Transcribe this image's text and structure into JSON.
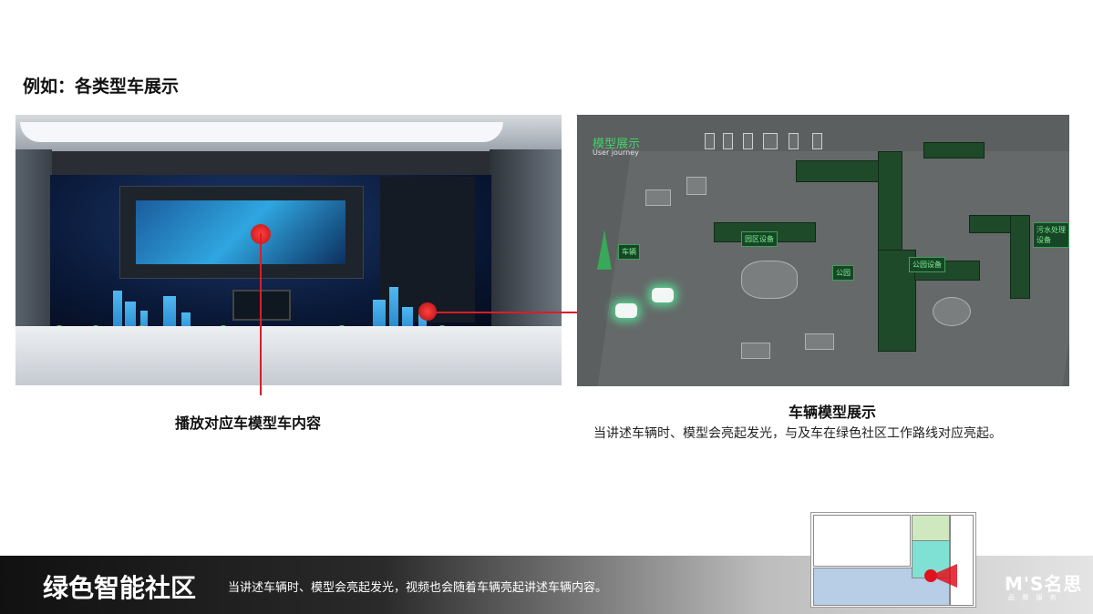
{
  "page": {
    "title": "例如：各类型车展示"
  },
  "left_exhibit": {
    "caption": "播放对应车模型车内容"
  },
  "right_map": {
    "title": "模型展示",
    "subtitle": "User journey",
    "car_label": "车辆",
    "caption_title": "车辆模型展示",
    "caption_body": "当讲述车辆时、模型会亮起发光，与及车在绿色社区工作路线对应亮起。"
  },
  "footer": {
    "title": "绿色智能社区",
    "description": "当讲述车辆时、模型会亮起发光，视频也会随着车辆亮起讲述车辆内容。",
    "brand": "M'S名思",
    "brand_sub": "品 牌 服 务"
  },
  "colors": {
    "accent_red": "#d81e2a",
    "map_green": "#43d06a",
    "footer_dark": "#111111"
  }
}
